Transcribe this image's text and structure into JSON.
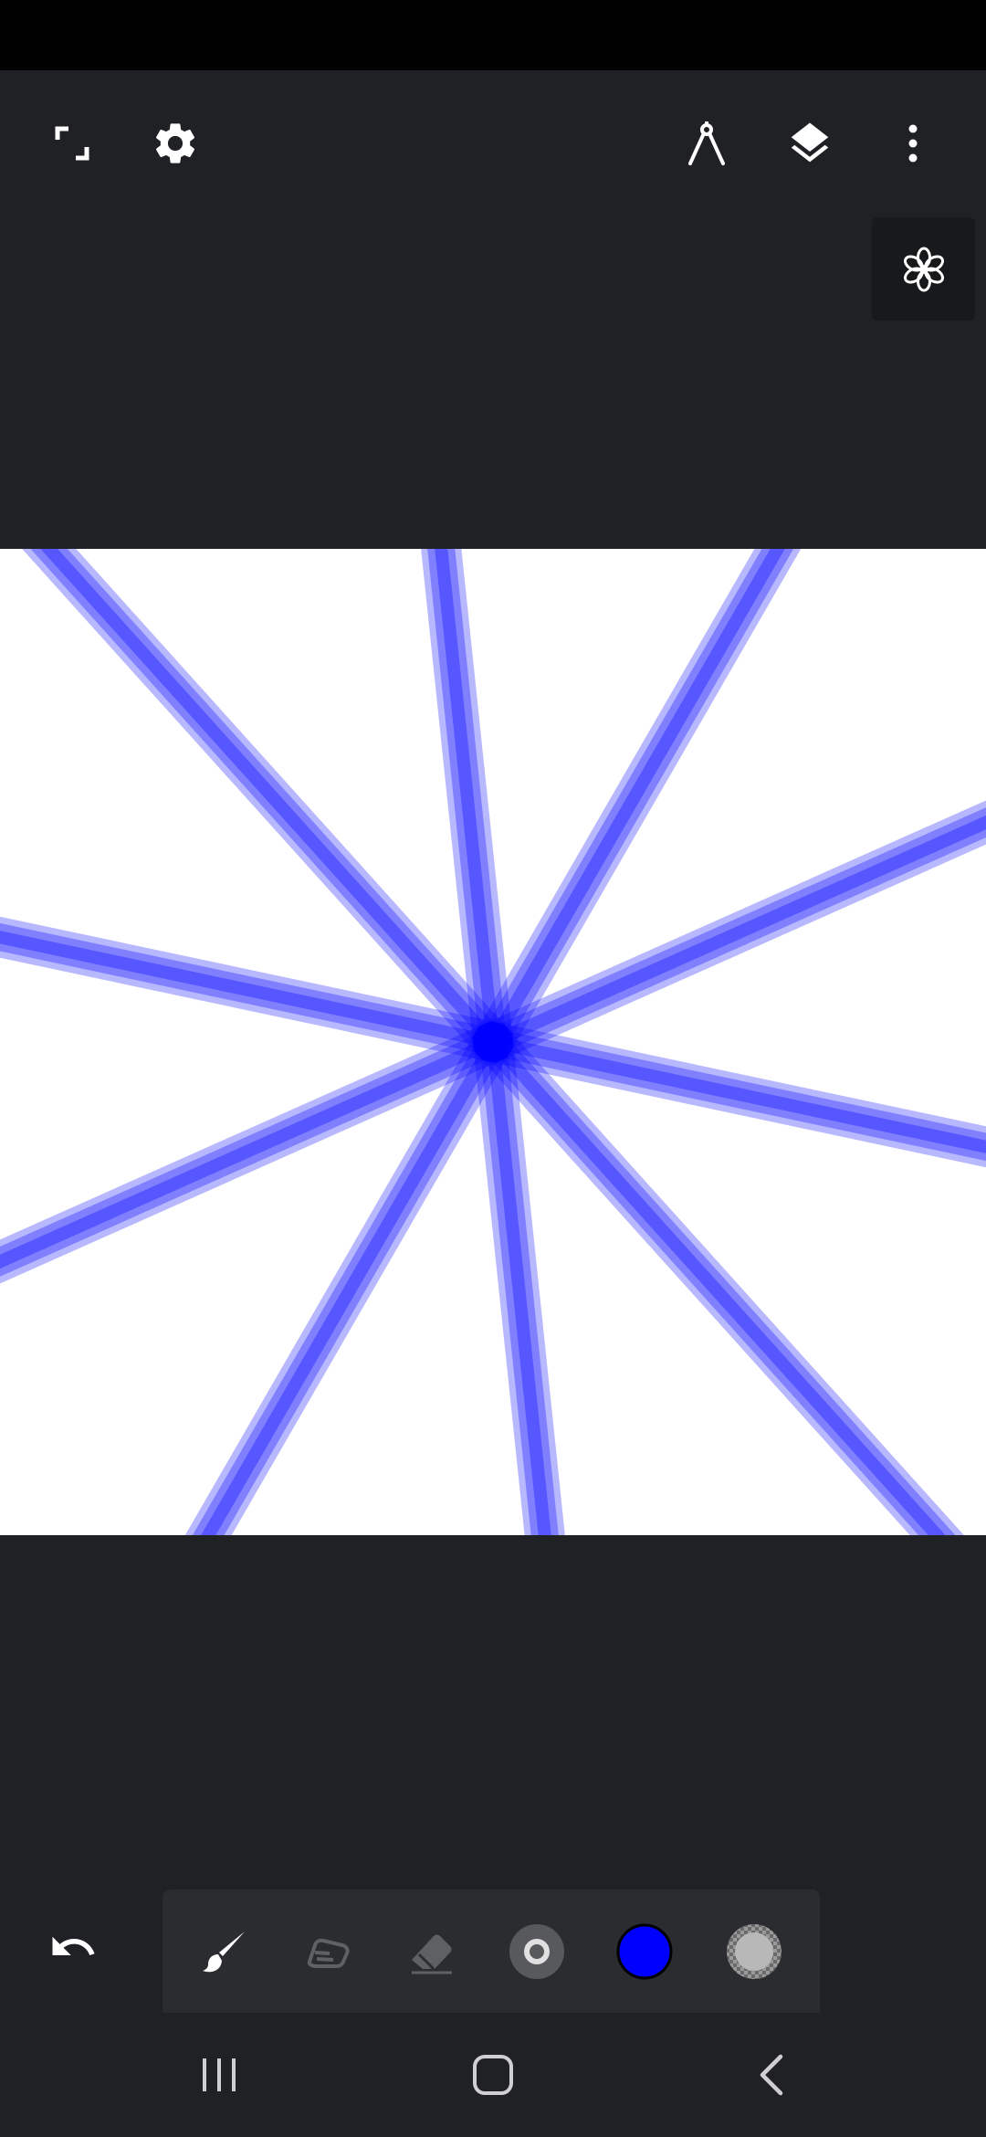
{
  "toolbar": {
    "left": [
      {
        "name": "fullscreen-icon"
      },
      {
        "name": "gear-icon"
      }
    ],
    "right": [
      {
        "name": "compass-icon"
      },
      {
        "name": "layers-icon"
      },
      {
        "name": "more-vert-icon"
      }
    ]
  },
  "symmetry": {
    "icon": "flower-icon"
  },
  "canvas": {
    "background": "#ffffff",
    "stroke": {
      "color": "#0000ff",
      "opacity": 0.45,
      "count": 10
    }
  },
  "bottom": {
    "undo": {
      "icon": "undo-icon"
    },
    "tools": [
      {
        "name": "brush-icon",
        "active": true
      },
      {
        "name": "smudge-icon",
        "active": false
      },
      {
        "name": "eraser-icon",
        "active": false
      },
      {
        "name": "brush-size-icon"
      },
      {
        "name": "color-swatch",
        "color": "#0000ff"
      },
      {
        "name": "opacity-icon"
      }
    ]
  },
  "nav": [
    {
      "name": "recents-icon"
    },
    {
      "name": "home-icon"
    },
    {
      "name": "back-icon"
    }
  ]
}
